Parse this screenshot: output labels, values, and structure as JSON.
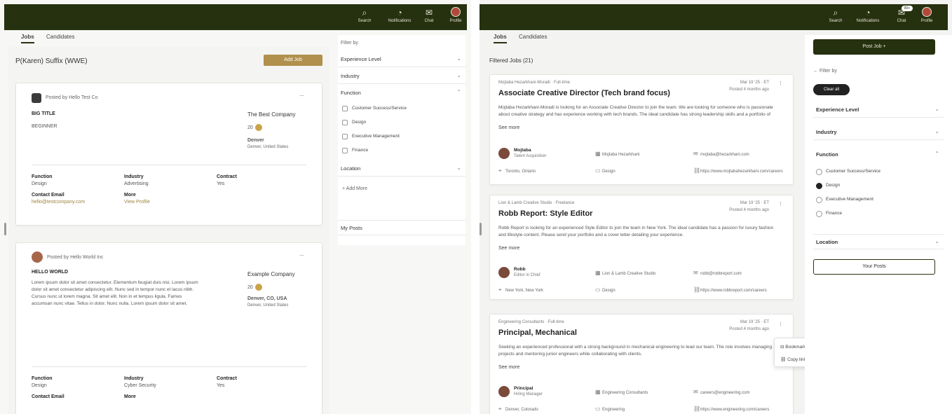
{
  "nav": {
    "items": [
      {
        "label": "Search",
        "icon": "search-icon",
        "glyph": "⌕"
      },
      {
        "label": "Notifications",
        "icon": "bell-icon",
        "glyph": "🔔"
      },
      {
        "label": "Chat",
        "icon": "chat-icon",
        "glyph": "✉"
      },
      {
        "label": "Profile",
        "icon": "profile-icon",
        "glyph": ""
      }
    ],
    "chat_badge": "99+",
    "accent_color": "#26310f"
  },
  "left": {
    "tabs": [
      "Jobs",
      "Candidates"
    ],
    "heading": "P(Karen) Suffix (WWE)",
    "gold_button": "Add Job",
    "cards": [
      {
        "company_line": "Posted by Hello Test Co",
        "title": "BIG TITLE",
        "sub": "BEGINNER",
        "company": "The Best Company",
        "rate": "20",
        "location": "Denver",
        "location_sub": "Denver, United States",
        "function_label": "Function",
        "function_value": "Design",
        "industry_label": "Industry",
        "industry_value": "Advertising",
        "contract_label": "Contract",
        "contract_value": "Yes",
        "email_label": "Contact Email",
        "email_value": "hello@testcompany.com",
        "more_label": "More",
        "more_value": "View Profile"
      },
      {
        "company_line": "Posted by Hello World Inc",
        "title": "HELLO WORLD",
        "sub": "Lorem ipsum dolor sit amet consectetur. Elementum feugiat duis nisi. Lorem ipsum dolor sit amet consectetur adipiscing elit. Nunc sed in tempor nunc et lacus nibh. Cursus nunc ut lorem magna. Sit amet elit. Non in et tempus ligula. Fames accumsan nunc vitae. Tellus in dolor. Nunc nulla. Lorem ipsum dolor sit amet.",
        "company": "Example Company",
        "rate": "20",
        "location": "Denver, CO, USA",
        "location_sub": "Denver, United States",
        "function_label": "Function",
        "function_value": "Design",
        "industry_label": "Industry",
        "industry_value": "Cyber Security",
        "contract_label": "Contract",
        "contract_value": "Yes",
        "email_label": "Contact Email",
        "more_label": "More"
      }
    ],
    "filters": {
      "heading": "Filter by",
      "rows": [
        "Experience Level",
        "Industry",
        "Function"
      ],
      "function_options": [
        {
          "label": "Customer Success/Service",
          "checked": false
        },
        {
          "label": "Design",
          "checked": false
        },
        {
          "label": "Executive Management",
          "checked": false
        },
        {
          "label": "Finance",
          "checked": false
        }
      ],
      "location": "Location",
      "add_more": "Add More",
      "my_posts": "My Posts"
    }
  },
  "right": {
    "tabs": [
      "Jobs",
      "Candidates"
    ],
    "heading": "Filtered Jobs (21)",
    "jobs": [
      {
        "company": "Mojtaba Hezarkhani-Moradi · Full-time",
        "title": "Associate Creative Director (Tech brand focus)",
        "date": "Mar 19 '25 · ET",
        "date_sub": "Posted 4 months ago",
        "desc": "Mojtaba Hezarkhani-Moradi is looking for an Associate Creative Director to join the team. We are looking for someone who is passionate about creative strategy and has experience working with tech brands. The ideal candidate has strong leadership skills and a portfolio of work.",
        "see_more": "See more",
        "person": "Mojtaba",
        "person_sub": "Talent Acquisition",
        "org": "Mojtaba Hezarkhani",
        "email": "mojtaba@hezarkhani.com",
        "loc": "Toronto, Ontario",
        "type": "Design",
        "link": "https://www.mojtabahezarkhani.com/careers"
      },
      {
        "company": "Lion & Lamb Creative Studio · Freelance",
        "title": "Robb Report: Style Editor",
        "date": "Mar 19 '25 · ET",
        "date_sub": "Posted 4 months ago",
        "desc": "Robb Report is looking for an experienced Style Editor to join the team in New York. The ideal candidate has a passion for luxury fashion and lifestyle content. Please send your portfolio and a cover letter detailing your experience.",
        "see_more": "See more",
        "person": "Robb",
        "person_sub": "Editor in Chief",
        "org": "Lion & Lamb Creative Studio",
        "email": "robb@robbreport.com",
        "loc": "New York, New York",
        "type": "Design",
        "link": "https://www.robbreport.com/careers"
      },
      {
        "company": "Engineering Consultants · Full-time",
        "title": "Principal, Mechanical",
        "date": "Mar 19 '25 · ET",
        "date_sub": "Posted 4 months ago",
        "desc": "Seeking an experienced professional with a strong background in mechanical engineering to lead our team. The role involves managing projects and mentoring junior engineers while collaborating with clients.",
        "see_more": "See more",
        "person": "Principal",
        "person_sub": "Hiring Manager",
        "org": "Engineering Consultants",
        "email": "careers@engineering.com",
        "loc": "Denver, Colorado",
        "type": "Engineering",
        "link": "https://www.engineering.com/careers"
      }
    ],
    "popup": {
      "items": [
        "Bookmark",
        "Copy link"
      ]
    },
    "post_job": "Post Job +",
    "filter_by": "Filter by",
    "chip": "Clear all",
    "filters": [
      "Experience Level",
      "Industry",
      "Function"
    ],
    "function_options": [
      {
        "label": "Customer Success/Service",
        "checked": false
      },
      {
        "label": "Design",
        "checked": true
      },
      {
        "label": "Executive Management",
        "checked": false
      },
      {
        "label": "Finance",
        "checked": false
      }
    ],
    "location": "Location",
    "your_posts": "Your Posts"
  }
}
